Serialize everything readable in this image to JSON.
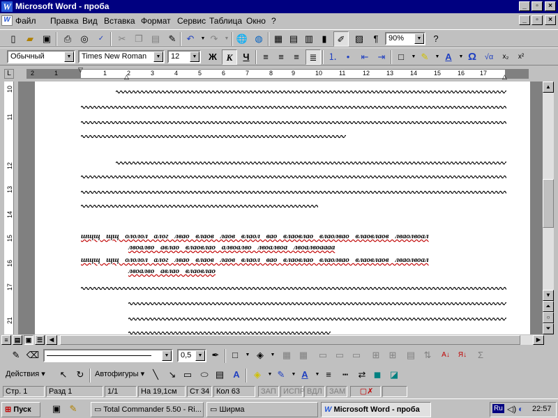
{
  "window": {
    "title": "Microsoft Word - проба",
    "app_logo": "W"
  },
  "menu": [
    "Файл",
    "Правка",
    "Вид",
    "Вставка",
    "Формат",
    "Сервис",
    "Таблица",
    "Окно",
    "?"
  ],
  "toolbar": {
    "zoom": "90%"
  },
  "format_bar": {
    "style": "Обычный",
    "font": "Times New Roman",
    "size": "12",
    "bold": "Ж",
    "italic": "К",
    "underline": "Ч",
    "omega": "Ω"
  },
  "ruler": {
    "numbers": [
      "2",
      "1",
      "1",
      "2",
      "3",
      "4",
      "5",
      "6",
      "7",
      "8",
      "9",
      "10",
      "11",
      "12",
      "13",
      "14",
      "15",
      "16",
      "17"
    ]
  },
  "vruler": {
    "numbers": [
      "10",
      "11",
      "12",
      "13",
      "14",
      "15",
      "16",
      "17",
      "21"
    ]
  },
  "document": {
    "para1": "шщщ  щщ  ололол  алог  лвао  влаов  лаов  влаол  вао  влаовлао  влаолвао  влаовлаов  лваолвоал",
    "para1_cont": "лвоалво авлао влаовлао алвоалво лвоалвоа лвоалвоаааа",
    "para2": "шщщ  щщ  ололол  алог  лвао  влаов  лаов  влаол  вао  влаовлао  влаолвао  влаовлаов  лваолвоал",
    "para2_cont": "лвоалво авлао влаовлао"
  },
  "draw_toolbar": {
    "width": "0,5",
    "actions": "Действия",
    "autoshapes": "Автофигуры"
  },
  "status": {
    "page": "Стр. 1",
    "section": "Разд 1",
    "pages": "1/1",
    "at": "На 19,1см",
    "line": "Ст 34",
    "col": "Кол 63",
    "rec": "ЗАП",
    "trk": "ИСПР",
    "ext": "ВДЛ",
    "ovr": "ЗАМ"
  },
  "taskbar": {
    "start": "Пуск",
    "task1": "Total Commander 5.50 - Ri...",
    "task2": "Ширма",
    "task3": "Microsoft Word - проба",
    "lang": "Ru",
    "clock": "22:57"
  }
}
